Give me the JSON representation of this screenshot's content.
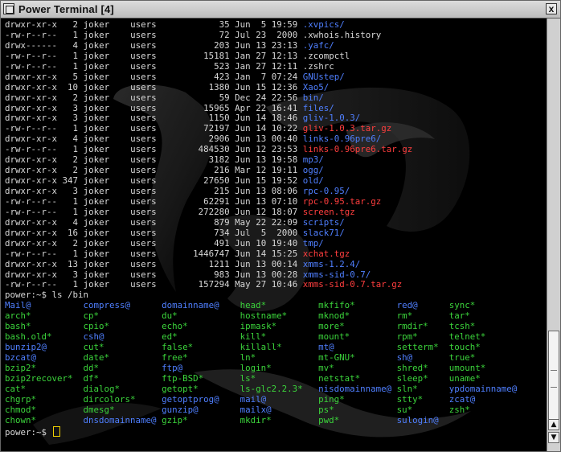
{
  "window": {
    "title": "Power Terminal  [4]",
    "close_icon_label": "x"
  },
  "colors": {
    "directory": "#4f7fff",
    "archive": "#ff3e3e",
    "executable": "#3bd43b",
    "text": "#d8d8d8",
    "cursor": "#f0d000"
  },
  "terminal": {
    "listing": [
      {
        "perm": "drwxr-xr-x",
        "links": "2",
        "owner": "joker",
        "group": "users",
        "size": "35",
        "month": "Jun",
        "day": "5",
        "time": "19:59",
        "name": ".xvpics/",
        "color": "blue"
      },
      {
        "perm": "-rw-r--r--",
        "links": "1",
        "owner": "joker",
        "group": "users",
        "size": "72",
        "month": "Jul",
        "day": "23",
        "time": "2000",
        "name": ".xwhois.history",
        "color": "default"
      },
      {
        "perm": "drwx------",
        "links": "4",
        "owner": "joker",
        "group": "users",
        "size": "203",
        "month": "Jun",
        "day": "13",
        "time": "23:13",
        "name": ".yafc/",
        "color": "blue"
      },
      {
        "perm": "-rw-r--r--",
        "links": "1",
        "owner": "joker",
        "group": "users",
        "size": "15181",
        "month": "Jan",
        "day": "27",
        "time": "12:13",
        "name": ".zcompctl",
        "color": "default"
      },
      {
        "perm": "-rw-r--r--",
        "links": "1",
        "owner": "joker",
        "group": "users",
        "size": "523",
        "month": "Jan",
        "day": "27",
        "time": "12:11",
        "name": ".zshrc",
        "color": "default"
      },
      {
        "perm": "drwxr-xr-x",
        "links": "5",
        "owner": "joker",
        "group": "users",
        "size": "423",
        "month": "Jan",
        "day": "7",
        "time": "07:24",
        "name": "GNUstep/",
        "color": "blue"
      },
      {
        "perm": "drwxr-xr-x",
        "links": "10",
        "owner": "joker",
        "group": "users",
        "size": "1380",
        "month": "Jun",
        "day": "15",
        "time": "12:36",
        "name": "Xao5/",
        "color": "blue"
      },
      {
        "perm": "drwxr-xr-x",
        "links": "2",
        "owner": "joker",
        "group": "users",
        "size": "59",
        "month": "Dec",
        "day": "24",
        "time": "22:56",
        "name": "bin/",
        "color": "blue"
      },
      {
        "perm": "drwxr-xr-x",
        "links": "3",
        "owner": "joker",
        "group": "users",
        "size": "15965",
        "month": "Apr",
        "day": "22",
        "time": "16:41",
        "name": "files/",
        "color": "blue"
      },
      {
        "perm": "drwxr-xr-x",
        "links": "3",
        "owner": "joker",
        "group": "users",
        "size": "1150",
        "month": "Jun",
        "day": "14",
        "time": "18:46",
        "name": "gliv-1.0.3/",
        "color": "blue"
      },
      {
        "perm": "-rw-r--r--",
        "links": "1",
        "owner": "joker",
        "group": "users",
        "size": "72197",
        "month": "Jun",
        "day": "14",
        "time": "10:22",
        "name": "gliv-1.0.3.tar.gz",
        "color": "red"
      },
      {
        "perm": "drwxr-xr-x",
        "links": "4",
        "owner": "joker",
        "group": "users",
        "size": "2906",
        "month": "Jun",
        "day": "13",
        "time": "00:40",
        "name": "links-0.96pre6/",
        "color": "blue"
      },
      {
        "perm": "-rw-r--r--",
        "links": "1",
        "owner": "joker",
        "group": "users",
        "size": "484530",
        "month": "Jun",
        "day": "12",
        "time": "23:53",
        "name": "links-0.96pre6.tar.gz",
        "color": "red"
      },
      {
        "perm": "drwxr-xr-x",
        "links": "2",
        "owner": "joker",
        "group": "users",
        "size": "3182",
        "month": "Jun",
        "day": "13",
        "time": "19:58",
        "name": "mp3/",
        "color": "blue"
      },
      {
        "perm": "drwxr-xr-x",
        "links": "2",
        "owner": "joker",
        "group": "users",
        "size": "216",
        "month": "Mar",
        "day": "12",
        "time": "19:11",
        "name": "ogg/",
        "color": "blue"
      },
      {
        "perm": "drwxr-xr-x",
        "links": "347",
        "owner": "joker",
        "group": "users",
        "size": "27650",
        "month": "Jun",
        "day": "15",
        "time": "19:52",
        "name": "old/",
        "color": "blue"
      },
      {
        "perm": "drwxr-xr-x",
        "links": "3",
        "owner": "joker",
        "group": "users",
        "size": "215",
        "month": "Jun",
        "day": "13",
        "time": "08:06",
        "name": "rpc-0.95/",
        "color": "blue"
      },
      {
        "perm": "-rw-r--r--",
        "links": "1",
        "owner": "joker",
        "group": "users",
        "size": "62291",
        "month": "Jun",
        "day": "13",
        "time": "07:10",
        "name": "rpc-0.95.tar.gz",
        "color": "red"
      },
      {
        "perm": "-rw-r--r--",
        "links": "1",
        "owner": "joker",
        "group": "users",
        "size": "272280",
        "month": "Jun",
        "day": "12",
        "time": "18:07",
        "name": "screen.tgz",
        "color": "red"
      },
      {
        "perm": "drwxr-xr-x",
        "links": "4",
        "owner": "joker",
        "group": "users",
        "size": "879",
        "month": "May",
        "day": "22",
        "time": "22:09",
        "name": "scripts/",
        "color": "blue"
      },
      {
        "perm": "drwxr-xr-x",
        "links": "16",
        "owner": "joker",
        "group": "users",
        "size": "734",
        "month": "Jul",
        "day": "5",
        "time": "2000",
        "name": "slack71/",
        "color": "blue"
      },
      {
        "perm": "drwxr-xr-x",
        "links": "2",
        "owner": "joker",
        "group": "users",
        "size": "491",
        "month": "Jun",
        "day": "10",
        "time": "19:40",
        "name": "tmp/",
        "color": "blue"
      },
      {
        "perm": "-rw-r--r--",
        "links": "1",
        "owner": "joker",
        "group": "users",
        "size": "1446747",
        "month": "Jun",
        "day": "14",
        "time": "15:25",
        "name": "xchat.tgz",
        "color": "red"
      },
      {
        "perm": "drwxr-xr-x",
        "links": "13",
        "owner": "joker",
        "group": "users",
        "size": "1211",
        "month": "Jun",
        "day": "13",
        "time": "00:14",
        "name": "xmms-1.2.4/",
        "color": "blue"
      },
      {
        "perm": "drwxr-xr-x",
        "links": "3",
        "owner": "joker",
        "group": "users",
        "size": "983",
        "month": "Jun",
        "day": "13",
        "time": "00:28",
        "name": "xmms-sid-0.7/",
        "color": "blue"
      },
      {
        "perm": "-rw-r--r--",
        "links": "1",
        "owner": "joker",
        "group": "users",
        "size": "157294",
        "month": "May",
        "day": "27",
        "time": "10:46",
        "name": "xmms-sid-0.7.tar.gz",
        "color": "red"
      }
    ],
    "command_prompt": "power:~$ ls /bin",
    "bin_columns": [
      [
        [
          "Mail@",
          "blue"
        ],
        [
          "arch*",
          "green"
        ],
        [
          "bash*",
          "green"
        ],
        [
          "bash.old*",
          "green"
        ],
        [
          "bunzip2@",
          "blue"
        ],
        [
          "bzcat@",
          "blue"
        ],
        [
          "bzip2*",
          "green"
        ],
        [
          "bzip2recover*",
          "green"
        ],
        [
          "cat*",
          "green"
        ],
        [
          "chgrp*",
          "green"
        ],
        [
          "chmod*",
          "green"
        ],
        [
          "chown*",
          "green"
        ]
      ],
      [
        [
          "compress@",
          "blue"
        ],
        [
          "cp*",
          "green"
        ],
        [
          "cpio*",
          "green"
        ],
        [
          "csh@",
          "blue"
        ],
        [
          "cut*",
          "green"
        ],
        [
          "date*",
          "green"
        ],
        [
          "dd*",
          "green"
        ],
        [
          "df*",
          "green"
        ],
        [
          "dialog*",
          "green"
        ],
        [
          "dircolors*",
          "green"
        ],
        [
          "dmesg*",
          "green"
        ],
        [
          "dnsdomainname@",
          "blue"
        ]
      ],
      [
        [
          "domainname@",
          "blue"
        ],
        [
          "du*",
          "green"
        ],
        [
          "echo*",
          "green"
        ],
        [
          "ed*",
          "green"
        ],
        [
          "false*",
          "green"
        ],
        [
          "free*",
          "green"
        ],
        [
          "ftp@",
          "blue"
        ],
        [
          "ftp-BSD*",
          "green"
        ],
        [
          "getopt*",
          "green"
        ],
        [
          "getoptprog@",
          "blue"
        ],
        [
          "gunzip@",
          "blue"
        ],
        [
          "gzip*",
          "green"
        ]
      ],
      [
        [
          "head*",
          "green"
        ],
        [
          "hostname*",
          "green"
        ],
        [
          "ipmask*",
          "green"
        ],
        [
          "kill*",
          "green"
        ],
        [
          "killall*",
          "green"
        ],
        [
          "ln*",
          "green"
        ],
        [
          "login*",
          "green"
        ],
        [
          "ls*",
          "green"
        ],
        [
          "ls-glc2.2.3*",
          "green"
        ],
        [
          "mail@",
          "blue"
        ],
        [
          "mailx@",
          "blue"
        ],
        [
          "mkdir*",
          "green"
        ]
      ],
      [
        [
          "mkfifo*",
          "green"
        ],
        [
          "mknod*",
          "green"
        ],
        [
          "more*",
          "green"
        ],
        [
          "mount*",
          "green"
        ],
        [
          "mt@",
          "blue"
        ],
        [
          "mt-GNU*",
          "green"
        ],
        [
          "mv*",
          "green"
        ],
        [
          "netstat*",
          "green"
        ],
        [
          "nisdomainname@",
          "blue"
        ],
        [
          "ping*",
          "green"
        ],
        [
          "ps*",
          "green"
        ],
        [
          "pwd*",
          "green"
        ]
      ],
      [
        [
          "red@",
          "blue"
        ],
        [
          "rm*",
          "green"
        ],
        [
          "rmdir*",
          "green"
        ],
        [
          "rpm*",
          "green"
        ],
        [
          "setterm*",
          "green"
        ],
        [
          "sh@",
          "blue"
        ],
        [
          "shred*",
          "green"
        ],
        [
          "sleep*",
          "green"
        ],
        [
          "sln*",
          "green"
        ],
        [
          "stty*",
          "green"
        ],
        [
          "su*",
          "green"
        ],
        [
          "sulogin@",
          "blue"
        ]
      ],
      [
        [
          "sync*",
          "green"
        ],
        [
          "tar*",
          "green"
        ],
        [
          "tcsh*",
          "green"
        ],
        [
          "telnet*",
          "green"
        ],
        [
          "touch*",
          "green"
        ],
        [
          "true*",
          "green"
        ],
        [
          "umount*",
          "green"
        ],
        [
          "uname*",
          "green"
        ],
        [
          "ypdomainname@",
          "blue"
        ],
        [
          "zcat@",
          "blue"
        ],
        [
          "zsh*",
          "green"
        ],
        [
          "",
          ""
        ]
      ]
    ],
    "final_prompt": "power:~$ "
  }
}
